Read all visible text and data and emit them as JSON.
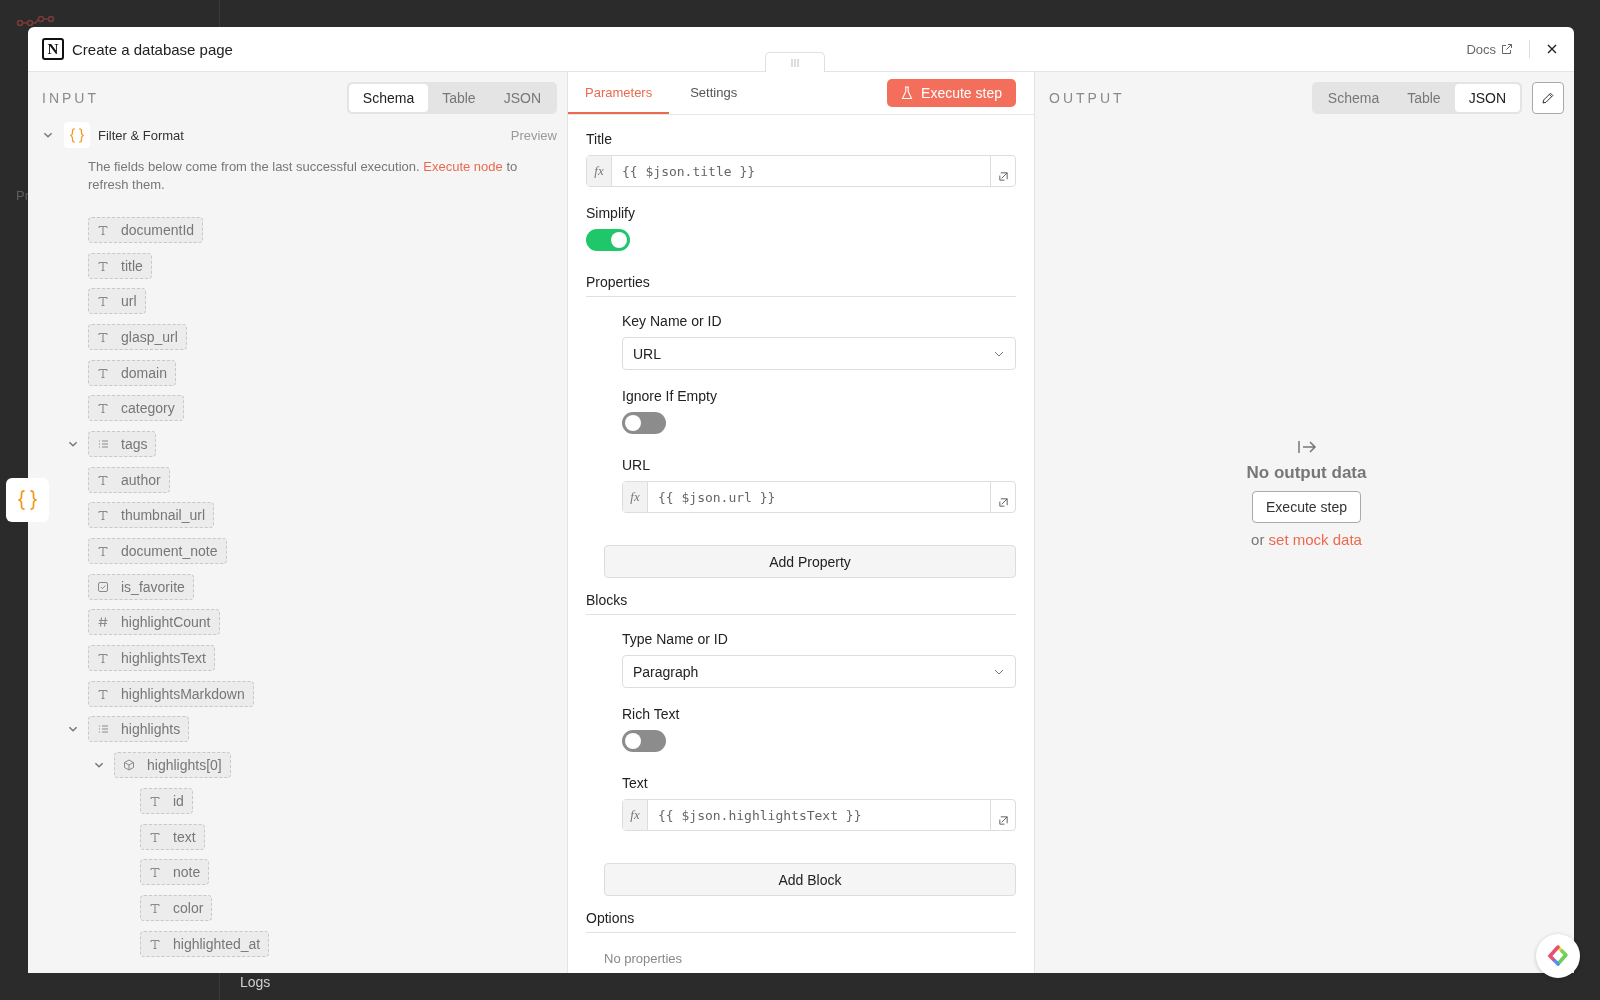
{
  "background": {
    "sidebar_cut_label": "Pr",
    "logs_label": "Logs"
  },
  "window": {
    "logo_letter": "N",
    "title": "Create a database page",
    "docs_link": "Docs"
  },
  "input": {
    "heading": "INPUT",
    "view_tabs": [
      {
        "label": "Schema",
        "selected": true
      },
      {
        "label": "Table",
        "selected": false
      },
      {
        "label": "JSON",
        "selected": false
      }
    ],
    "node": {
      "name": "Filter & Format",
      "expanded": true,
      "preview": "Preview",
      "notice": "The fields below come from the last successful execution.",
      "notice_link": "Execute node",
      "notice_end": "to refresh them."
    },
    "tree": [
      {
        "kind": "string",
        "name": "documentId"
      },
      {
        "kind": "string",
        "name": "title"
      },
      {
        "kind": "string",
        "name": "url"
      },
      {
        "kind": "string",
        "name": "glasp_url"
      },
      {
        "kind": "string",
        "name": "domain"
      },
      {
        "kind": "string",
        "name": "category"
      },
      {
        "kind": "array",
        "name": "tags",
        "expanded": true
      },
      {
        "kind": "string",
        "name": "author"
      },
      {
        "kind": "string",
        "name": "thumbnail_url"
      },
      {
        "kind": "string",
        "name": "document_note"
      },
      {
        "kind": "boolean",
        "name": "is_favorite"
      },
      {
        "kind": "number",
        "name": "highlightCount"
      },
      {
        "kind": "string",
        "name": "highlightsText"
      },
      {
        "kind": "string",
        "name": "highlightsMarkdown"
      },
      {
        "kind": "array",
        "name": "highlights",
        "expanded": true,
        "children": [
          {
            "kind": "object",
            "name": "highlights[0]",
            "expanded": true,
            "children": [
              {
                "kind": "string",
                "name": "id"
              },
              {
                "kind": "string",
                "name": "text"
              },
              {
                "kind": "string",
                "name": "note"
              },
              {
                "kind": "string",
                "name": "color"
              },
              {
                "kind": "string",
                "name": "highlighted_at"
              }
            ]
          }
        ]
      }
    ]
  },
  "parameters": {
    "tabs": [
      {
        "label": "Parameters",
        "selected": true
      },
      {
        "label": "Settings",
        "selected": false
      }
    ],
    "execute_button": "Execute step",
    "title_field": {
      "label": "Title",
      "prefix": "fx",
      "value": "{{ $json.title }}"
    },
    "simplify": {
      "label": "Simplify",
      "on": true
    },
    "sections": [
      {
        "heading": "Properties",
        "items": [
          {
            "kind": "select",
            "label": "Key Name or ID",
            "value": "URL"
          },
          {
            "kind": "toggle",
            "label": "Ignore If Empty",
            "on": false
          },
          {
            "kind": "expression",
            "label": "URL",
            "prefix": "fx",
            "value": "{{ $json.url }}"
          }
        ],
        "add_button": "Add Property"
      },
      {
        "heading": "Blocks",
        "items": [
          {
            "kind": "select",
            "label": "Type Name or ID",
            "value": "Paragraph"
          },
          {
            "kind": "toggle",
            "label": "Rich Text",
            "on": false
          },
          {
            "kind": "expression",
            "label": "Text",
            "prefix": "fx",
            "value": "{{ $json.highlightsText }}"
          }
        ],
        "add_button": "Add Block"
      },
      {
        "heading": "Options",
        "empty_text": "No properties"
      }
    ]
  },
  "output": {
    "heading": "OUTPUT",
    "view_tabs": [
      {
        "label": "Schema",
        "selected": false
      },
      {
        "label": "Table",
        "selected": false
      },
      {
        "label": "JSON",
        "selected": true
      }
    ],
    "empty_title": "No output data",
    "execute_button": "Execute step",
    "or_text": "or",
    "mock_link": "set mock data"
  }
}
